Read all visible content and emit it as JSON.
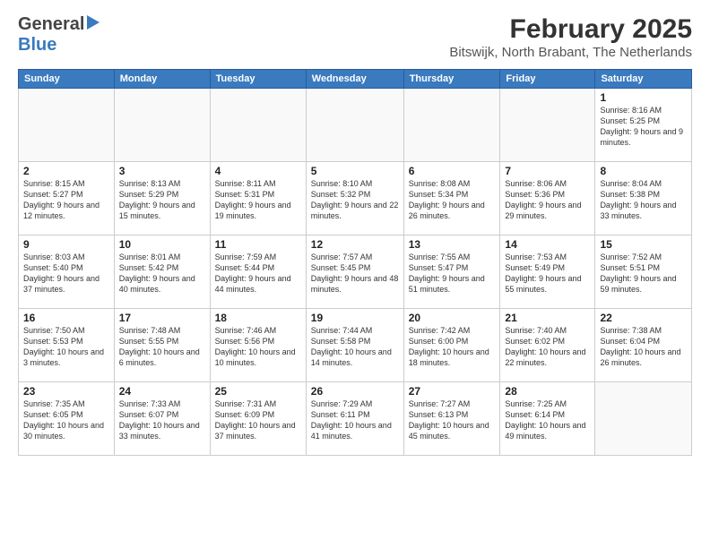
{
  "header": {
    "logo_general": "General",
    "logo_blue": "Blue",
    "main_title": "February 2025",
    "sub_title": "Bitswijk, North Brabant, The Netherlands"
  },
  "weekdays": [
    "Sunday",
    "Monday",
    "Tuesday",
    "Wednesday",
    "Thursday",
    "Friday",
    "Saturday"
  ],
  "weeks": [
    [
      {
        "num": "",
        "info": "",
        "empty": true
      },
      {
        "num": "",
        "info": "",
        "empty": true
      },
      {
        "num": "",
        "info": "",
        "empty": true
      },
      {
        "num": "",
        "info": "",
        "empty": true
      },
      {
        "num": "",
        "info": "",
        "empty": true
      },
      {
        "num": "",
        "info": "",
        "empty": true
      },
      {
        "num": "1",
        "info": "Sunrise: 8:16 AM\nSunset: 5:25 PM\nDaylight: 9 hours and 9 minutes.",
        "empty": false
      }
    ],
    [
      {
        "num": "2",
        "info": "Sunrise: 8:15 AM\nSunset: 5:27 PM\nDaylight: 9 hours and 12 minutes.",
        "empty": false
      },
      {
        "num": "3",
        "info": "Sunrise: 8:13 AM\nSunset: 5:29 PM\nDaylight: 9 hours and 15 minutes.",
        "empty": false
      },
      {
        "num": "4",
        "info": "Sunrise: 8:11 AM\nSunset: 5:31 PM\nDaylight: 9 hours and 19 minutes.",
        "empty": false
      },
      {
        "num": "5",
        "info": "Sunrise: 8:10 AM\nSunset: 5:32 PM\nDaylight: 9 hours and 22 minutes.",
        "empty": false
      },
      {
        "num": "6",
        "info": "Sunrise: 8:08 AM\nSunset: 5:34 PM\nDaylight: 9 hours and 26 minutes.",
        "empty": false
      },
      {
        "num": "7",
        "info": "Sunrise: 8:06 AM\nSunset: 5:36 PM\nDaylight: 9 hours and 29 minutes.",
        "empty": false
      },
      {
        "num": "8",
        "info": "Sunrise: 8:04 AM\nSunset: 5:38 PM\nDaylight: 9 hours and 33 minutes.",
        "empty": false
      }
    ],
    [
      {
        "num": "9",
        "info": "Sunrise: 8:03 AM\nSunset: 5:40 PM\nDaylight: 9 hours and 37 minutes.",
        "empty": false
      },
      {
        "num": "10",
        "info": "Sunrise: 8:01 AM\nSunset: 5:42 PM\nDaylight: 9 hours and 40 minutes.",
        "empty": false
      },
      {
        "num": "11",
        "info": "Sunrise: 7:59 AM\nSunset: 5:44 PM\nDaylight: 9 hours and 44 minutes.",
        "empty": false
      },
      {
        "num": "12",
        "info": "Sunrise: 7:57 AM\nSunset: 5:45 PM\nDaylight: 9 hours and 48 minutes.",
        "empty": false
      },
      {
        "num": "13",
        "info": "Sunrise: 7:55 AM\nSunset: 5:47 PM\nDaylight: 9 hours and 51 minutes.",
        "empty": false
      },
      {
        "num": "14",
        "info": "Sunrise: 7:53 AM\nSunset: 5:49 PM\nDaylight: 9 hours and 55 minutes.",
        "empty": false
      },
      {
        "num": "15",
        "info": "Sunrise: 7:52 AM\nSunset: 5:51 PM\nDaylight: 9 hours and 59 minutes.",
        "empty": false
      }
    ],
    [
      {
        "num": "16",
        "info": "Sunrise: 7:50 AM\nSunset: 5:53 PM\nDaylight: 10 hours and 3 minutes.",
        "empty": false
      },
      {
        "num": "17",
        "info": "Sunrise: 7:48 AM\nSunset: 5:55 PM\nDaylight: 10 hours and 6 minutes.",
        "empty": false
      },
      {
        "num": "18",
        "info": "Sunrise: 7:46 AM\nSunset: 5:56 PM\nDaylight: 10 hours and 10 minutes.",
        "empty": false
      },
      {
        "num": "19",
        "info": "Sunrise: 7:44 AM\nSunset: 5:58 PM\nDaylight: 10 hours and 14 minutes.",
        "empty": false
      },
      {
        "num": "20",
        "info": "Sunrise: 7:42 AM\nSunset: 6:00 PM\nDaylight: 10 hours and 18 minutes.",
        "empty": false
      },
      {
        "num": "21",
        "info": "Sunrise: 7:40 AM\nSunset: 6:02 PM\nDaylight: 10 hours and 22 minutes.",
        "empty": false
      },
      {
        "num": "22",
        "info": "Sunrise: 7:38 AM\nSunset: 6:04 PM\nDaylight: 10 hours and 26 minutes.",
        "empty": false
      }
    ],
    [
      {
        "num": "23",
        "info": "Sunrise: 7:35 AM\nSunset: 6:05 PM\nDaylight: 10 hours and 30 minutes.",
        "empty": false
      },
      {
        "num": "24",
        "info": "Sunrise: 7:33 AM\nSunset: 6:07 PM\nDaylight: 10 hours and 33 minutes.",
        "empty": false
      },
      {
        "num": "25",
        "info": "Sunrise: 7:31 AM\nSunset: 6:09 PM\nDaylight: 10 hours and 37 minutes.",
        "empty": false
      },
      {
        "num": "26",
        "info": "Sunrise: 7:29 AM\nSunset: 6:11 PM\nDaylight: 10 hours and 41 minutes.",
        "empty": false
      },
      {
        "num": "27",
        "info": "Sunrise: 7:27 AM\nSunset: 6:13 PM\nDaylight: 10 hours and 45 minutes.",
        "empty": false
      },
      {
        "num": "28",
        "info": "Sunrise: 7:25 AM\nSunset: 6:14 PM\nDaylight: 10 hours and 49 minutes.",
        "empty": false
      },
      {
        "num": "",
        "info": "",
        "empty": true
      }
    ]
  ]
}
